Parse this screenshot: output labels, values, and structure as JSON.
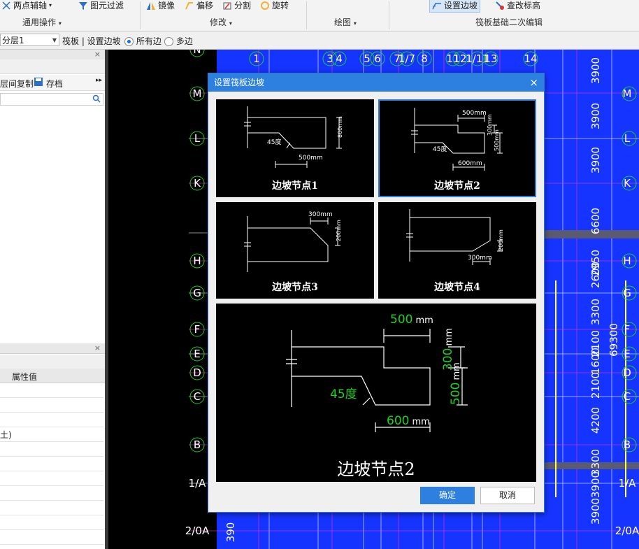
{
  "ribbon": {
    "items": [
      "两点辅轴",
      "图元过滤",
      "镜像",
      "偏移",
      "分割",
      "旋转",
      "设置边坡",
      "查改标高"
    ],
    "groups": [
      "通用操作",
      "修改",
      "绘图",
      "筏板基础二次编辑"
    ]
  },
  "toolbar": {
    "floor_value": "分层1",
    "crumb": "筏板 | 设置边坡",
    "radio_all": "所有边",
    "radio_multi": "多边"
  },
  "left_panel": {
    "copy_label": "层间复制",
    "save_label": "存档",
    "prop_header": "属性值",
    "prop_fragment": "土)"
  },
  "drawing": {
    "top_axis": [
      "1",
      "3",
      "4",
      "5",
      "6",
      "7",
      "1/7",
      "8",
      "11",
      "12",
      "1/11",
      "13",
      "14"
    ],
    "left_axis": [
      "N",
      "M",
      "L",
      "K",
      "H",
      "G",
      "F",
      "E",
      "D",
      "C",
      "B",
      "1/A",
      "2/0A"
    ],
    "right_axis": [
      "M",
      "L",
      "K",
      "H",
      "G",
      "F",
      "E",
      "D",
      "C",
      "B",
      "1/A",
      "2/0A"
    ],
    "right_dims": [
      "3900",
      "3900",
      "3900",
      "6600",
      "2950",
      "2600",
      "3300",
      "2100",
      "1600",
      "2100",
      "4200",
      "3300",
      "3900",
      "3900"
    ],
    "total_dim": "69300",
    "left_dim": "390"
  },
  "dialog": {
    "title": "设置筏板边坡",
    "close_glyph": "×",
    "confirm_label": "确定",
    "cancel_label": "取消",
    "nodes": [
      {
        "label": "边坡节点1",
        "dims": [
          "800mm",
          "500mm",
          "45度"
        ]
      },
      {
        "label": "边坡节点2",
        "dims": [
          "500mm",
          "300mm",
          "500mm",
          "600mm",
          "45度"
        ]
      },
      {
        "label": "边坡节点3",
        "dims": [
          "300mm",
          "200mm"
        ]
      },
      {
        "label": "边坡节点4",
        "dims": [
          "200mm",
          "300mm"
        ]
      }
    ],
    "preview": {
      "label": "边坡节点2",
      "dim_top": "500",
      "dim_right_top": "300",
      "dim_right_bottom": "500",
      "dim_bottom": "600",
      "unit": "mm",
      "angle": "45度"
    }
  }
}
